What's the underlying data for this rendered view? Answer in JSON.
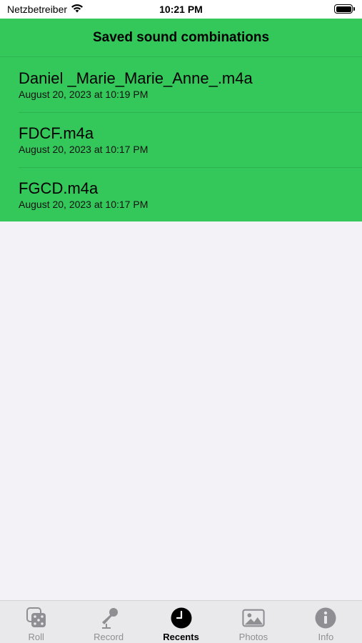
{
  "status_bar": {
    "carrier": "Netzbetreiber",
    "time": "10:21 PM"
  },
  "header": {
    "title": "Saved sound combinations"
  },
  "recordings": [
    {
      "name": "Daniel _Marie_Marie_Anne_.m4a",
      "date": "August 20, 2023 at 10:19 PM"
    },
    {
      "name": "FDCF.m4a",
      "date": "August 20, 2023 at 10:17 PM"
    },
    {
      "name": "FGCD.m4a",
      "date": "August 20, 2023 at 10:17 PM"
    }
  ],
  "tabs": [
    {
      "label": "Roll",
      "icon": "dice-icon",
      "active": false
    },
    {
      "label": "Record",
      "icon": "microphone-icon",
      "active": false
    },
    {
      "label": "Recents",
      "icon": "clock-icon",
      "active": true
    },
    {
      "label": "Photos",
      "icon": "photo-icon",
      "active": false
    },
    {
      "label": "Info",
      "icon": "info-icon",
      "active": false
    }
  ],
  "colors": {
    "accent_green": "#34c759",
    "background": "#f2f2f7",
    "tab_inactive": "#8e8e93"
  }
}
